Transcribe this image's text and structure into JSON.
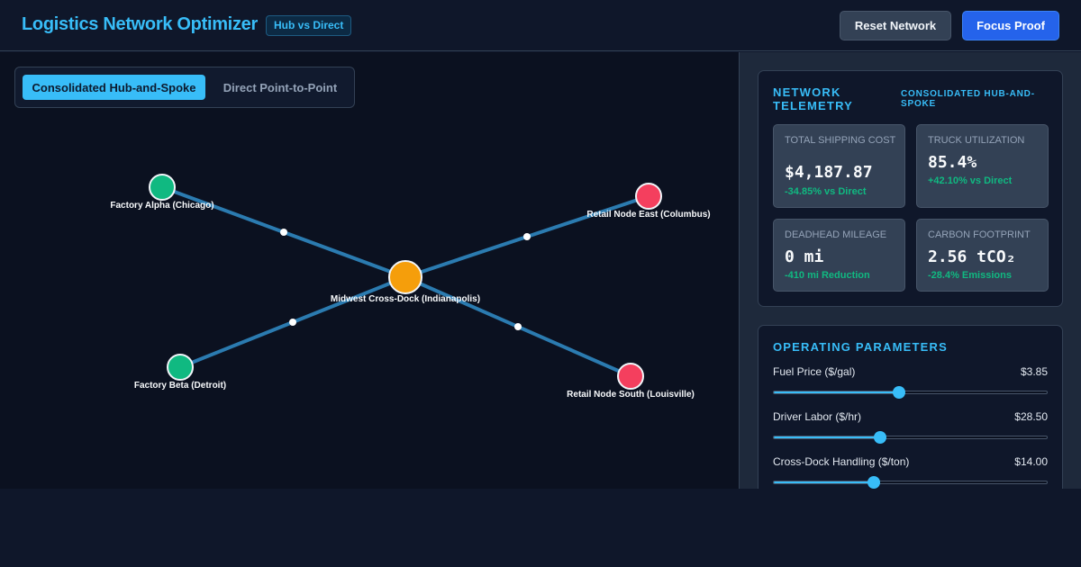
{
  "header": {
    "title": "Logistics Network Optimizer",
    "badge": "Hub vs Direct",
    "reset_label": "Reset Network",
    "focus_label": "Focus Proof"
  },
  "mode_toggle": {
    "options": [
      "Consolidated Hub-and-Spoke",
      "Direct Point-to-Point"
    ],
    "selected": "Consolidated Hub-and-Spoke"
  },
  "network": {
    "nodes": [
      {
        "id": "factory-alpha",
        "label": "Factory Alpha (Chicago)",
        "type": "factory",
        "color": "#10b981"
      },
      {
        "id": "factory-beta",
        "label": "Factory Beta (Detroit)",
        "type": "factory",
        "color": "#10b981"
      },
      {
        "id": "hub",
        "label": "Midwest Cross-Dock (Indianapolis)",
        "type": "hub",
        "color": "#f59e0b"
      },
      {
        "id": "retail-east",
        "label": "Retail Node East (Columbus)",
        "type": "retail",
        "color": "#f43f5e"
      },
      {
        "id": "retail-south",
        "label": "Retail Node South (Louisville)",
        "type": "retail",
        "color": "#f43f5e"
      }
    ],
    "routes": [
      {
        "from": "factory-alpha",
        "to": "hub"
      },
      {
        "from": "factory-beta",
        "to": "hub"
      },
      {
        "from": "hub",
        "to": "retail-east"
      },
      {
        "from": "hub",
        "to": "retail-south"
      }
    ],
    "route_color": "#2b7bb0"
  },
  "telemetry": {
    "title": "Network Telemetry",
    "mode": "Consolidated Hub-and-Spoke",
    "metrics": [
      {
        "label": "Total Shipping Cost",
        "value": "$4,187.87",
        "delta": "-34.85% vs Direct"
      },
      {
        "label": "Truck Utilization",
        "value": "85.4%",
        "delta": "+42.10% vs Direct"
      },
      {
        "label": "Deadhead Mileage",
        "value": "0 mi",
        "delta": "-410 mi Reduction"
      },
      {
        "label": "Carbon Footprint",
        "value": "2.56 tCO₂",
        "delta": "-28.4% Emissions"
      }
    ]
  },
  "parameters": {
    "title": "Operating Parameters",
    "items": [
      {
        "name": "Fuel Price ($/gal)",
        "value": "$3.85",
        "fraction": 0.46
      },
      {
        "name": "Driver Labor ($/hr)",
        "value": "$28.50",
        "fraction": 0.39
      },
      {
        "name": "Cross-Dock Handling ($/ton)",
        "value": "$14.00",
        "fraction": 0.365
      }
    ]
  },
  "colors": {
    "accent": "#38bdf8",
    "primary_button": "#2563eb",
    "positive": "#10b981",
    "factory": "#10b981",
    "hub": "#f59e0b",
    "retail": "#f43f5e"
  }
}
